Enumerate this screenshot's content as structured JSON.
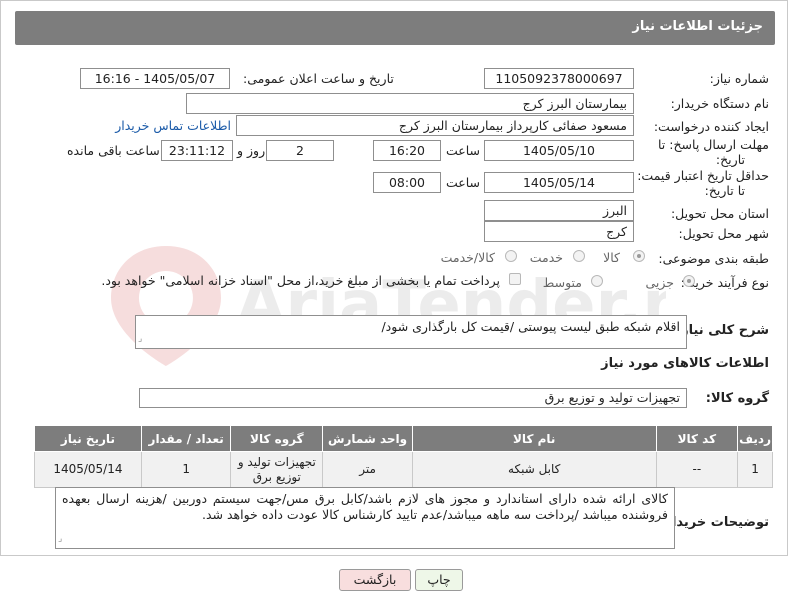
{
  "panel_title": "جزئیات اطلاعات نیاز",
  "need_number": {
    "label": "شماره نیاز:",
    "value": "1105092378000697"
  },
  "announce_datetime": {
    "label": "تاریخ و ساعت اعلان عمومی:",
    "value": "1405/05/07 - 16:16"
  },
  "buyer_org": {
    "label": "نام دستگاه خریدار:",
    "value": "بیمارستان البرز کرج"
  },
  "requester": {
    "label": "ایجاد کننده درخواست:",
    "value": "مسعود صفائی کارپرداز بیمارستان البرز کرج",
    "contact_link": "اطلاعات تماس خریدار"
  },
  "reply_deadline": {
    "label": "مهلت ارسال پاسخ: تا تاریخ:",
    "date": "1405/05/10",
    "time_label": "ساعت",
    "time": "16:20",
    "days": "2",
    "days_label": "روز و",
    "remaining": "23:11:12",
    "remaining_label": "ساعت باقی مانده"
  },
  "price_validity": {
    "label": "حداقل تاریخ اعتبار قیمت: تا تاریخ:",
    "date": "1405/05/14",
    "time_label": "ساعت",
    "time": "08:00"
  },
  "province": {
    "label": "استان محل تحویل:",
    "value": "البرز"
  },
  "city": {
    "label": "شهر محل تحویل:",
    "value": "کرج"
  },
  "category": {
    "label": "طبقه بندی موضوعی:",
    "options": [
      "کالا",
      "خدمت",
      "کالا/خدمت"
    ],
    "selected": "کالا"
  },
  "purchase_type": {
    "label": "نوع فرآیند خرید :",
    "options": [
      "جزیی",
      "متوسط"
    ],
    "selected": "جزیی",
    "payment_note": "پرداخت تمام یا بخشی از مبلغ خرید،از محل \"اسناد خزانه اسلامی\" خواهد بود."
  },
  "description": {
    "label": "شرح کلی نیاز:",
    "value": "اقلام شبکه طبق لیست پیوستی /قیمت کل بارگذاری شود/"
  },
  "goods_info_title": "اطلاعات کالاهای مورد نیاز",
  "goods_group": {
    "label": "گروه کالا:",
    "value": "تجهیزات تولید و توزیع برق"
  },
  "table": {
    "headers": [
      "ردیف",
      "کد کالا",
      "نام کالا",
      "واحد شمارش",
      "گروه کالا",
      "تعداد / مقدار",
      "تاریخ نیاز"
    ],
    "rows": [
      [
        "1",
        "--",
        "کابل شبکه",
        "متر",
        "تجهیزات تولید و توزیع برق",
        "1",
        "1405/05/14"
      ]
    ]
  },
  "buyer_notes": {
    "label": "توضیحات خریدار:",
    "value": "کالای ارائه شده دارای استاندارد و مجوز های لازم باشد/کابل  برق مس/جهت سیستم دوربین /هزینه ارسال بعهده فروشنده میباشد /پرداخت سه ماهه میباشد/عدم تایید کارشناس کالا عودت داده خواهد شد."
  },
  "buttons": {
    "print": "چاپ",
    "back": "بازگشت"
  },
  "watermark_text": "AriaTender.neT",
  "colors": {
    "header_bg": "#7d7d7d",
    "link": "#1a5aa8",
    "print_btn": "#eef7e8",
    "back_btn": "#f8dede"
  }
}
